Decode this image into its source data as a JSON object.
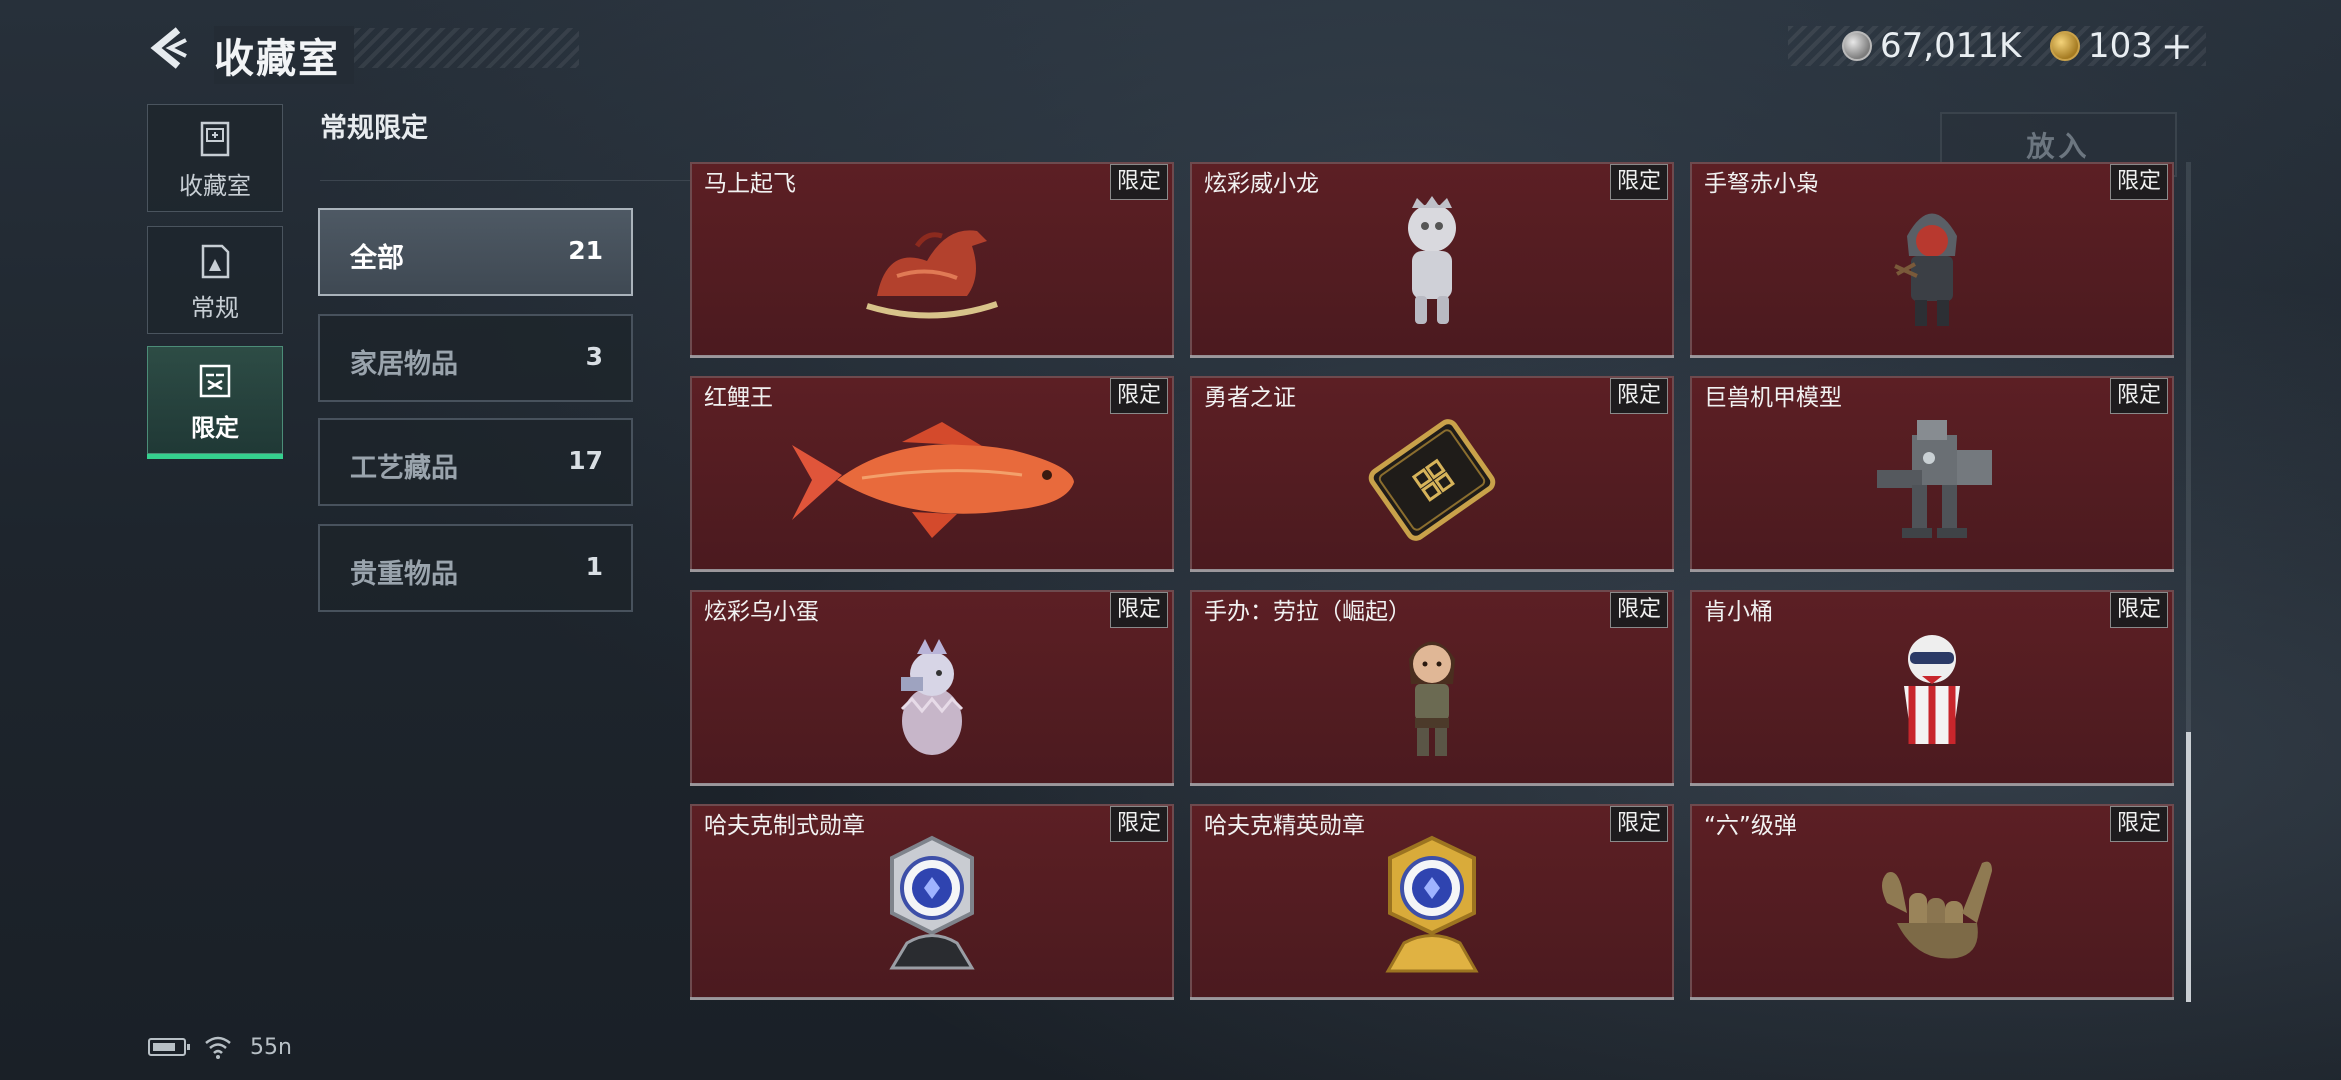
{
  "header": {
    "title": "收藏室",
    "currency_silver": "67,011K",
    "currency_gold": "103",
    "add_symbol": "+"
  },
  "sidebar": {
    "items": [
      {
        "label": "收藏室",
        "icon": "vault-icon"
      },
      {
        "label": "常规",
        "icon": "document-icon"
      },
      {
        "label": "限定",
        "icon": "limited-icon",
        "active": true
      }
    ]
  },
  "section_label": "常规限定",
  "categories": [
    {
      "name": "全部",
      "count": "21",
      "active": true
    },
    {
      "name": "家居物品",
      "count": "3"
    },
    {
      "name": "工艺藏品",
      "count": "17"
    },
    {
      "name": "贵重物品",
      "count": "1"
    }
  ],
  "place_button": "放入",
  "items": [
    {
      "name": "马上起飞",
      "tag": "限定",
      "icon": "rocking-horse-icon"
    },
    {
      "name": "炫彩威小龙",
      "tag": "限定",
      "icon": "dragon-figure-icon"
    },
    {
      "name": "手弩赤小枭",
      "tag": "限定",
      "icon": "hooded-figure-icon"
    },
    {
      "name": "红鲤王",
      "tag": "限定",
      "icon": "red-carp-icon"
    },
    {
      "name": "勇者之证",
      "tag": "限定",
      "icon": "card-icon"
    },
    {
      "name": "巨兽机甲模型",
      "tag": "限定",
      "icon": "mech-icon"
    },
    {
      "name": "炫彩乌小蛋",
      "tag": "限定",
      "icon": "egg-figure-icon"
    },
    {
      "name": "手办：劳拉（崛起）",
      "tag": "限定",
      "icon": "lara-figure-icon"
    },
    {
      "name": "肯小桶",
      "tag": "限定",
      "icon": "bucket-figure-icon"
    },
    {
      "name": "哈夫克制式勋章",
      "tag": "限定",
      "icon": "silver-medal-icon"
    },
    {
      "name": "哈夫克精英勋章",
      "tag": "限定",
      "icon": "gold-medal-icon"
    },
    {
      "name": "“六”级弹",
      "tag": "限定",
      "icon": "hand-gesture-icon"
    }
  ],
  "status": {
    "signal_text": "55n"
  },
  "colors": {
    "accent": "#35d08e",
    "card_bg": "#5c1f24",
    "background": "#1e252d"
  }
}
